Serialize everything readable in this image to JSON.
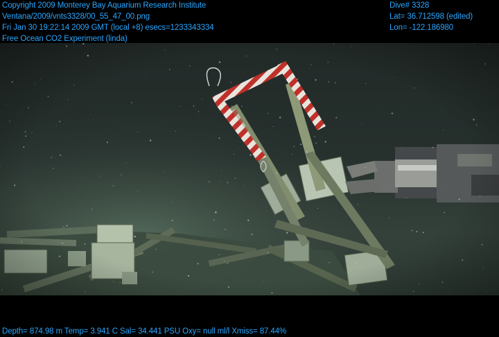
{
  "overlay": {
    "top_left": [
      "Copyright 2009 Monterey Bay Aquarium Research Institute",
      "Ventana/2009/vnts3328/00_55_47_00.png",
      "Fri Jan 30 19:22:14 2009 GMT (local +8)  esecs=1233343334",
      "Free Ocean CO2 Experiment (linda)"
    ],
    "top_right": [
      "Dive# 3328",
      "Lat= 36.712598 (edited)",
      "Lon= -122.186980"
    ],
    "bottom": "Depth= 874.98 m  Temp= 3.941 C  Sal= 34.441 PSU  Oxy= null ml/l  Xmiss= 87.44%"
  },
  "colors": {
    "overlay_text": "#2aa6ff",
    "water": "#25322f",
    "seafloor": "#3a4a3c",
    "stripe_red": "#c0302a",
    "stripe_white": "#e8e4dc"
  }
}
